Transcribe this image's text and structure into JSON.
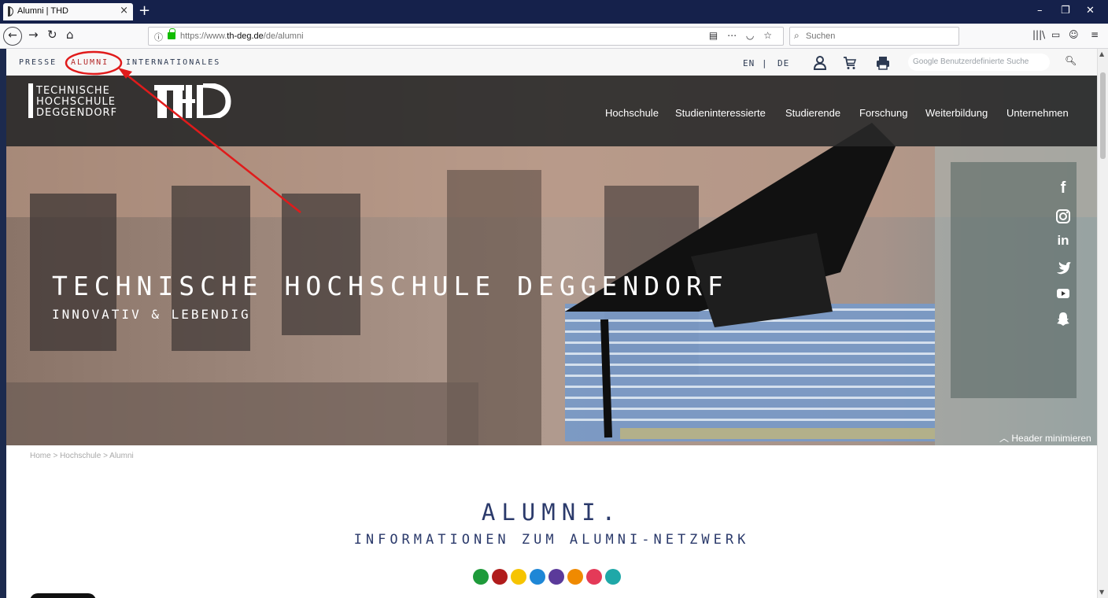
{
  "browser": {
    "tab_title": "Alumni | THD",
    "url_prefix": "https://www.",
    "url_host": "th-deg.de",
    "url_path": "/de/alumni",
    "search_placeholder": "Suchen"
  },
  "utility_nav": {
    "links": [
      "Presse",
      "Alumni",
      "Internationales"
    ],
    "lang_en": "EN",
    "lang_sep": "|",
    "lang_de": "DE",
    "search_placeholder": "Google Benutzerdefinierte Suche"
  },
  "logo": {
    "line1": "TECHNISCHE",
    "line2": "HOCHSCHULE",
    "line3": "DEGGENDORF",
    "mark": "THD"
  },
  "main_nav": {
    "items": [
      "Hochschule",
      "Studieninteressierte",
      "Studierende",
      "Forschung",
      "Weiterbildung",
      "Unternehmen"
    ]
  },
  "hero": {
    "title": "Technische Hochschule Deggendorf",
    "subtitle": "Innovativ & Lebendig",
    "header_minimize": "Header minimieren",
    "social": [
      "facebook-icon",
      "instagram-icon",
      "linkedin-icon",
      "twitter-icon",
      "youtube-icon",
      "snapchat-icon"
    ]
  },
  "breadcrumb": "Home > Hochschule > Alumni",
  "page": {
    "title": "Alumni.",
    "subtitle": "Informationen zum Alumni-Netzwerk",
    "dot_colors": [
      "#1e9a3a",
      "#b01c1c",
      "#f6c400",
      "#1e87d6",
      "#5b3a9a",
      "#f08a00",
      "#e43a58",
      "#1fa8a8"
    ]
  },
  "colors": {
    "brand_navy": "#2b3a6b",
    "annotation_red": "#e01b1b"
  }
}
